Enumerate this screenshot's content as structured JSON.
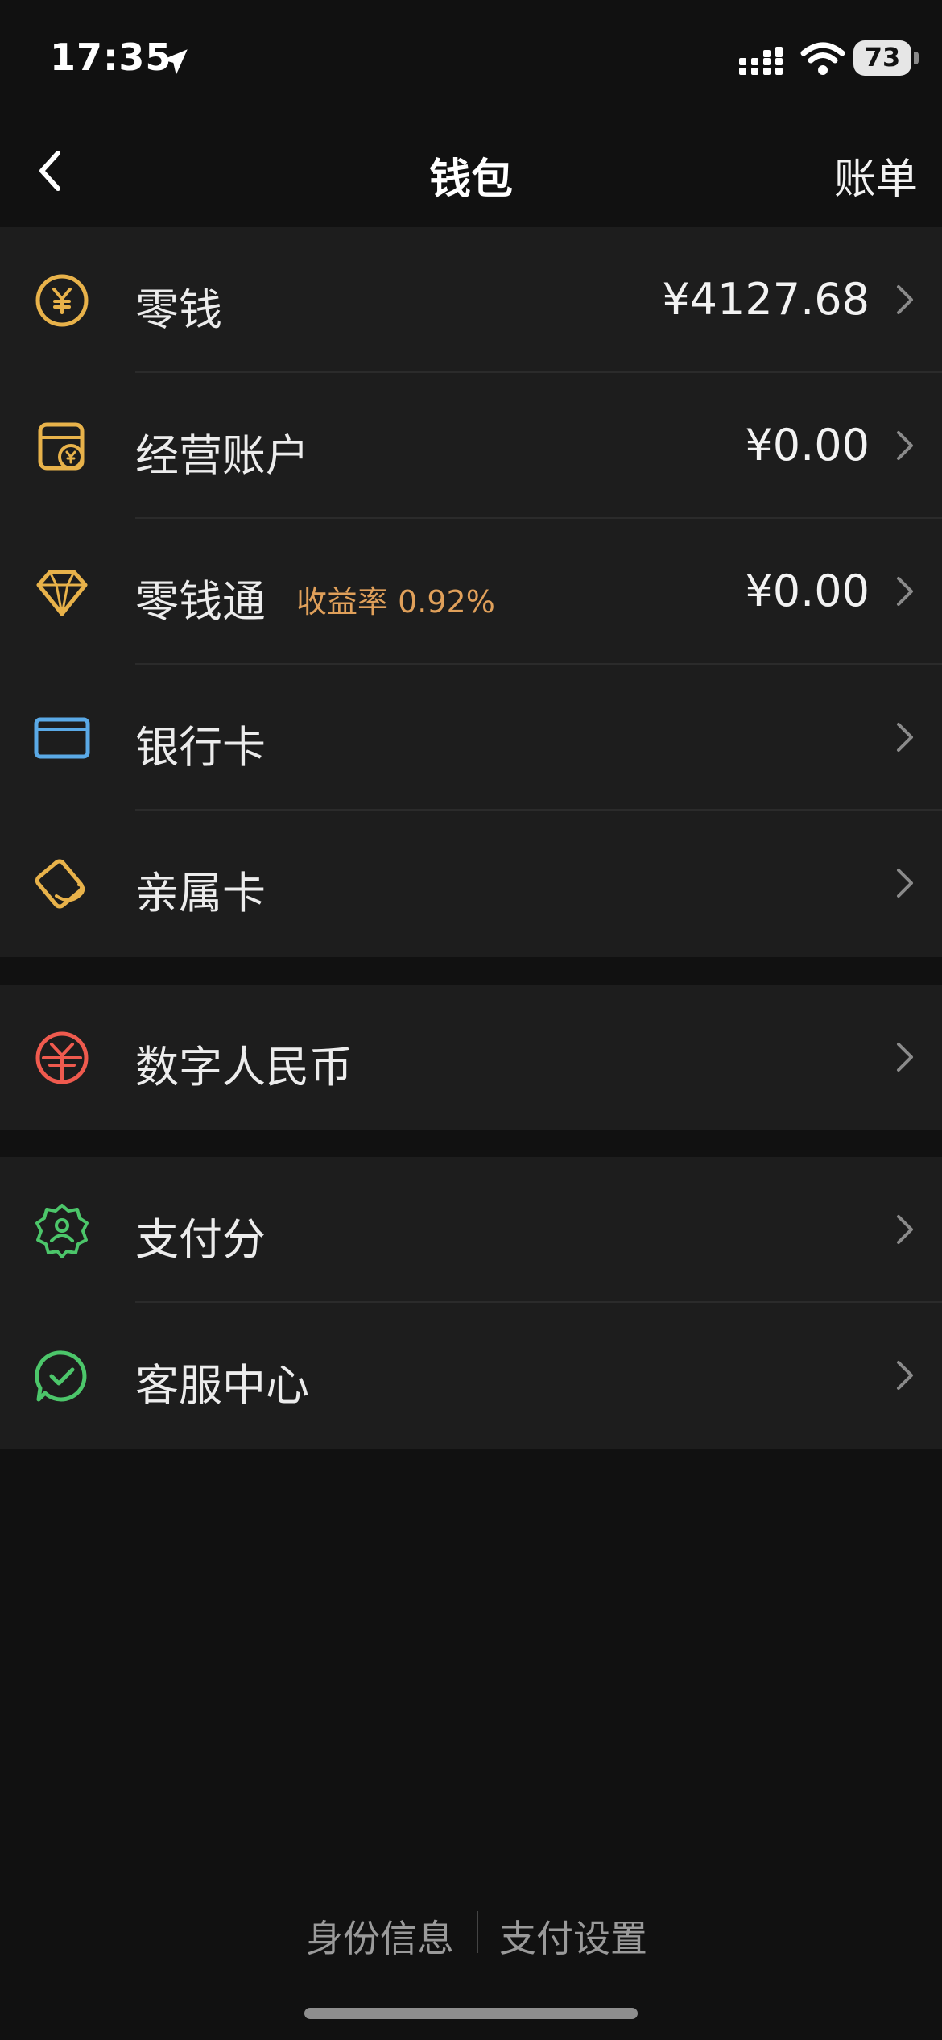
{
  "status_bar": {
    "time": "17:35",
    "battery_level": "73",
    "icons": [
      "location-arrow-icon",
      "cellular-signal-icon",
      "wifi-icon",
      "battery-icon"
    ]
  },
  "nav": {
    "back_icon": "chevron-left-icon",
    "title": "钱包",
    "right_action": "账单"
  },
  "groups": [
    {
      "items": [
        {
          "label": "零钱",
          "value": "¥4127.68",
          "icon": "yuan-coin-icon",
          "icon_color": "#e8b24a"
        },
        {
          "label": "经营账户",
          "value": "¥0.00",
          "icon": "store-account-icon",
          "icon_color": "#e8b24a"
        },
        {
          "label": "零钱通",
          "sublabel": "收益率 0.92%",
          "value": "¥0.00",
          "icon": "diamond-icon",
          "icon_color": "#e8b24a"
        },
        {
          "label": "银行卡",
          "value": "",
          "icon": "bank-card-icon",
          "icon_color": "#5aa9e6"
        },
        {
          "label": "亲属卡",
          "value": "",
          "icon": "family-card-icon",
          "icon_color": "#e8b24a"
        }
      ]
    },
    {
      "items": [
        {
          "label": "数字人民币",
          "value": "",
          "icon": "digital-rmb-icon",
          "icon_color": "#ef5a4e"
        }
      ]
    },
    {
      "items": [
        {
          "label": "支付分",
          "value": "",
          "icon": "pay-score-icon",
          "icon_color": "#4cc66a"
        },
        {
          "label": "客服中心",
          "value": "",
          "icon": "customer-service-icon",
          "icon_color": "#4cc66a"
        }
      ]
    }
  ],
  "footer": {
    "links": [
      "身份信息",
      "支付设置"
    ]
  },
  "colors": {
    "background": "#111111",
    "card": "#1d1d1d",
    "accent_gold": "#e8b24a",
    "accent_blue": "#5aa9e6",
    "accent_red": "#ef5a4e",
    "accent_green": "#4cc66a",
    "sublabel_orange": "#e0a05a"
  }
}
